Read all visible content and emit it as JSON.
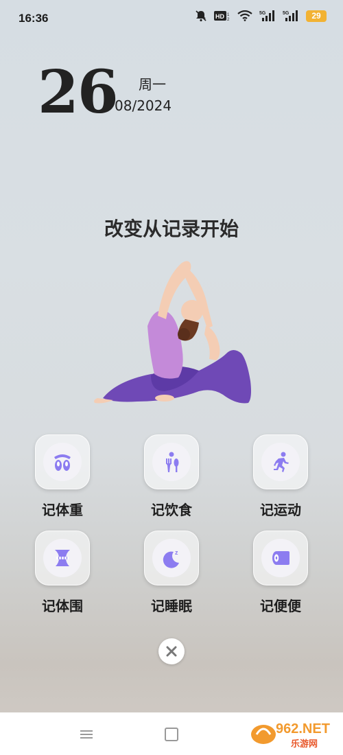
{
  "status": {
    "time": "16:36",
    "battery": "29"
  },
  "date": {
    "day": "26",
    "weekday": "周一",
    "month_year": "08/2024"
  },
  "slogan": "改变从记录开始",
  "tiles": [
    {
      "label": "记体重",
      "icon": "weight-feet-icon"
    },
    {
      "label": "记饮食",
      "icon": "utensils-icon"
    },
    {
      "label": "记运动",
      "icon": "running-icon"
    },
    {
      "label": "记体围",
      "icon": "body-measure-icon"
    },
    {
      "label": "记睡眠",
      "icon": "moon-sleep-icon"
    },
    {
      "label": "记便便",
      "icon": "toilet-paper-icon"
    }
  ],
  "watermark": {
    "brand": "962.NET",
    "sub": "乐游网"
  },
  "colors": {
    "accent": "#8c7cf0",
    "battery": "#f2b233"
  }
}
